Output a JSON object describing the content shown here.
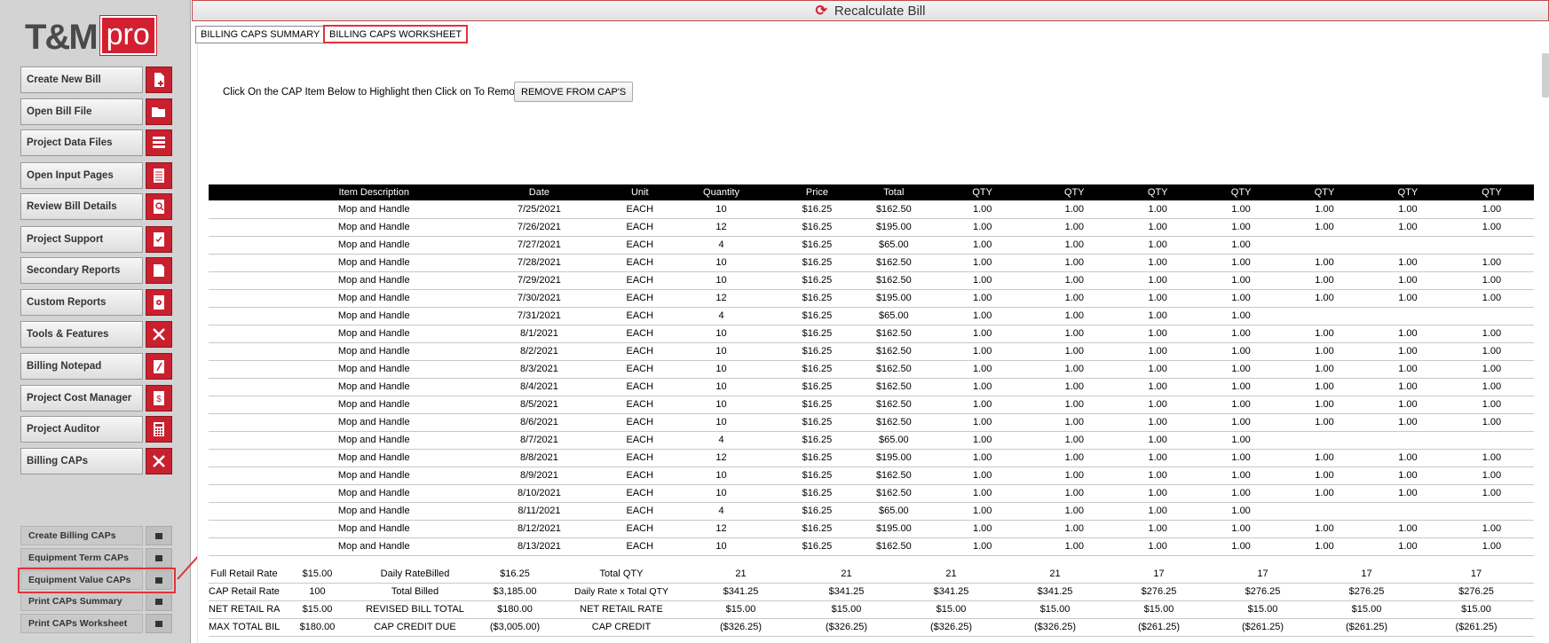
{
  "app": {
    "logo_main": "T&M",
    "logo_accent": "pro",
    "brand_color": "#d32030"
  },
  "topbar": {
    "title": "Recalculate Bill",
    "icon": "refresh-icon"
  },
  "tabs": [
    {
      "label": "BILLING CAPS SUMMARY",
      "active": false
    },
    {
      "label": "BILLING CAPS WORKSHEET",
      "active": true
    }
  ],
  "sidebar": {
    "items": [
      {
        "label": "Create New Bill",
        "icon": "new-file-icon"
      },
      {
        "label": "Open Bill File",
        "icon": "folder-open-icon"
      },
      {
        "label": "Project Data Files",
        "icon": "list-icon"
      },
      {
        "label": "Open Input Pages",
        "icon": "pages-icon"
      },
      {
        "label": "Review Bill Details",
        "icon": "magnify-document-icon"
      },
      {
        "label": "Project Support",
        "icon": "checklist-icon"
      },
      {
        "label": "Secondary Reports",
        "icon": "document-icon"
      },
      {
        "label": "Custom Reports",
        "icon": "gear-document-icon"
      },
      {
        "label": "Tools & Features",
        "icon": "tools-icon"
      },
      {
        "label": "Billing Notepad",
        "icon": "notepad-icon"
      },
      {
        "label": "Project Cost Manager",
        "icon": "dollar-document-icon"
      },
      {
        "label": "Project Auditor",
        "icon": "calculator-icon"
      },
      {
        "label": "Billing CAPs",
        "icon": "close-icon"
      }
    ],
    "sub_items": [
      {
        "label": "Create Billing CAPs"
      },
      {
        "label": "Equipment Term CAPs"
      },
      {
        "label": "Equipment Value CAPs"
      },
      {
        "label": "Print CAPs Summary"
      },
      {
        "label": "Print CAPs Worksheet"
      }
    ]
  },
  "worksheet": {
    "instruction": "Click On the CAP Item Below to Highlight then Click on To Remove",
    "remove_button": "REMOVE FROM CAP'S",
    "columns": [
      "",
      "Item Description",
      "Date",
      "Unit",
      "Quantity",
      "Price",
      "Total",
      "QTY",
      "QTY",
      "QTY",
      "QTY",
      "QTY",
      "QTY",
      "QTY"
    ],
    "rows": [
      [
        "",
        "Mop and Handle",
        "7/25/2021",
        "EACH",
        "10",
        "$16.25",
        "$162.50",
        "1.00",
        "1.00",
        "1.00",
        "1.00",
        "1.00",
        "1.00",
        "1.00"
      ],
      [
        "",
        "Mop and Handle",
        "7/26/2021",
        "EACH",
        "12",
        "$16.25",
        "$195.00",
        "1.00",
        "1.00",
        "1.00",
        "1.00",
        "1.00",
        "1.00",
        "1.00"
      ],
      [
        "",
        "Mop and Handle",
        "7/27/2021",
        "EACH",
        "4",
        "$16.25",
        "$65.00",
        "1.00",
        "1.00",
        "1.00",
        "1.00",
        "",
        "",
        ""
      ],
      [
        "",
        "Mop and Handle",
        "7/28/2021",
        "EACH",
        "10",
        "$16.25",
        "$162.50",
        "1.00",
        "1.00",
        "1.00",
        "1.00",
        "1.00",
        "1.00",
        "1.00"
      ],
      [
        "",
        "Mop and Handle",
        "7/29/2021",
        "EACH",
        "10",
        "$16.25",
        "$162.50",
        "1.00",
        "1.00",
        "1.00",
        "1.00",
        "1.00",
        "1.00",
        "1.00"
      ],
      [
        "",
        "Mop and Handle",
        "7/30/2021",
        "EACH",
        "12",
        "$16.25",
        "$195.00",
        "1.00",
        "1.00",
        "1.00",
        "1.00",
        "1.00",
        "1.00",
        "1.00"
      ],
      [
        "",
        "Mop and Handle",
        "7/31/2021",
        "EACH",
        "4",
        "$16.25",
        "$65.00",
        "1.00",
        "1.00",
        "1.00",
        "1.00",
        "",
        "",
        ""
      ],
      [
        "",
        "Mop and Handle",
        "8/1/2021",
        "EACH",
        "10",
        "$16.25",
        "$162.50",
        "1.00",
        "1.00",
        "1.00",
        "1.00",
        "1.00",
        "1.00",
        "1.00"
      ],
      [
        "",
        "Mop and Handle",
        "8/2/2021",
        "EACH",
        "10",
        "$16.25",
        "$162.50",
        "1.00",
        "1.00",
        "1.00",
        "1.00",
        "1.00",
        "1.00",
        "1.00"
      ],
      [
        "",
        "Mop and Handle",
        "8/3/2021",
        "EACH",
        "10",
        "$16.25",
        "$162.50",
        "1.00",
        "1.00",
        "1.00",
        "1.00",
        "1.00",
        "1.00",
        "1.00"
      ],
      [
        "",
        "Mop and Handle",
        "8/4/2021",
        "EACH",
        "10",
        "$16.25",
        "$162.50",
        "1.00",
        "1.00",
        "1.00",
        "1.00",
        "1.00",
        "1.00",
        "1.00"
      ],
      [
        "",
        "Mop and Handle",
        "8/5/2021",
        "EACH",
        "10",
        "$16.25",
        "$162.50",
        "1.00",
        "1.00",
        "1.00",
        "1.00",
        "1.00",
        "1.00",
        "1.00"
      ],
      [
        "",
        "Mop and Handle",
        "8/6/2021",
        "EACH",
        "10",
        "$16.25",
        "$162.50",
        "1.00",
        "1.00",
        "1.00",
        "1.00",
        "1.00",
        "1.00",
        "1.00"
      ],
      [
        "",
        "Mop and Handle",
        "8/7/2021",
        "EACH",
        "4",
        "$16.25",
        "$65.00",
        "1.00",
        "1.00",
        "1.00",
        "1.00",
        "",
        "",
        ""
      ],
      [
        "",
        "Mop and Handle",
        "8/8/2021",
        "EACH",
        "12",
        "$16.25",
        "$195.00",
        "1.00",
        "1.00",
        "1.00",
        "1.00",
        "1.00",
        "1.00",
        "1.00"
      ],
      [
        "",
        "Mop and Handle",
        "8/9/2021",
        "EACH",
        "10",
        "$16.25",
        "$162.50",
        "1.00",
        "1.00",
        "1.00",
        "1.00",
        "1.00",
        "1.00",
        "1.00"
      ],
      [
        "",
        "Mop and Handle",
        "8/10/2021",
        "EACH",
        "10",
        "$16.25",
        "$162.50",
        "1.00",
        "1.00",
        "1.00",
        "1.00",
        "1.00",
        "1.00",
        "1.00"
      ],
      [
        "",
        "Mop and Handle",
        "8/11/2021",
        "EACH",
        "4",
        "$16.25",
        "$65.00",
        "1.00",
        "1.00",
        "1.00",
        "1.00",
        "",
        "",
        ""
      ],
      [
        "",
        "Mop and Handle",
        "8/12/2021",
        "EACH",
        "12",
        "$16.25",
        "$195.00",
        "1.00",
        "1.00",
        "1.00",
        "1.00",
        "1.00",
        "1.00",
        "1.00"
      ],
      [
        "",
        "Mop and Handle",
        "8/13/2021",
        "EACH",
        "10",
        "$16.25",
        "$162.50",
        "1.00",
        "1.00",
        "1.00",
        "1.00",
        "1.00",
        "1.00",
        "1.00"
      ]
    ]
  },
  "summary": {
    "rows": [
      [
        "Full Retail Rate",
        "$15.00",
        "Daily RateBilled",
        "$16.25",
        "Total QTY",
        "21",
        "21",
        "21",
        "21",
        "17",
        "17",
        "17",
        "17"
      ],
      [
        "CAP Retail Rate %",
        "100",
        "Total Billed",
        "$3,185.00",
        "Daily Rate x Total QTY",
        "$341.25",
        "$341.25",
        "$341.25",
        "$341.25",
        "$276.25",
        "$276.25",
        "$276.25",
        "$276.25"
      ],
      [
        "NET RETAIL RATE",
        "$15.00",
        "REVISED BILL TOTAL",
        "$180.00",
        "NET RETAIL RATE",
        "$15.00",
        "$15.00",
        "$15.00",
        "$15.00",
        "$15.00",
        "$15.00",
        "$15.00",
        "$15.00"
      ],
      [
        "MAX TOTAL BILLING",
        "$180.00",
        "CAP CREDIT DUE",
        "($3,005.00)",
        "CAP CREDIT",
        "($326.25)",
        "($326.25)",
        "($326.25)",
        "($326.25)",
        "($261.25)",
        "($261.25)",
        "($261.25)",
        "($261.25)"
      ]
    ]
  }
}
